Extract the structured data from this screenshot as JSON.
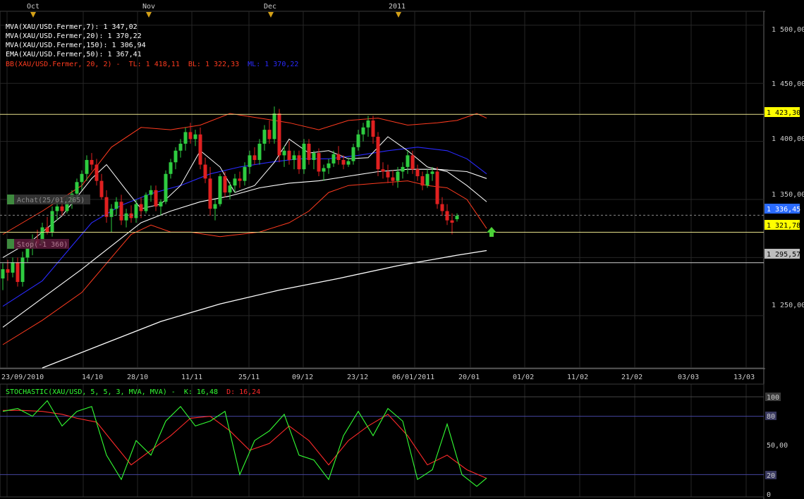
{
  "top_axis": {
    "months": [
      "Oct",
      "Nov",
      "Dec",
      "2011"
    ]
  },
  "legend": [
    {
      "text": "MVA(XAU/USD.Fermer,7): 1 347,02",
      "color": "#ffffff"
    },
    {
      "text": "MVA(XAU/USD.Fermer,20): 1 370,22",
      "color": "#ffffff"
    },
    {
      "text": "MVA(XAU/USD.Fermer,150): 1 306,94",
      "color": "#ffffff"
    },
    {
      "text": "EMA(XAU/USD.Fermer,50): 1 367,41",
      "color": "#ffffff"
    }
  ],
  "legend_bb": {
    "prefix": "BB(XAU/USD.Fermer, 20, 2) -",
    "tl": "TL: 1 418,11",
    "bl": "BL: 1 322,33",
    "ml": "ML: 1 370,22",
    "color": "#ff3b1f",
    "ml_color": "#2a2aff"
  },
  "price_axis": {
    "ticks": [
      "1 500,00",
      "1 450,00",
      "1 400,00",
      "1 350,00",
      "1 250,00"
    ]
  },
  "price_tags": [
    {
      "label": "1 423,30",
      "bg": "#ffff00",
      "fg": "#000000"
    },
    {
      "label": "1 336,45",
      "bg": "#2a6bff",
      "fg": "#ffffff"
    },
    {
      "label": "1 321,78",
      "bg": "#ffff00",
      "fg": "#000000"
    },
    {
      "label": "1 295,57",
      "bg": "#bdbdbd",
      "fg": "#000000"
    }
  ],
  "annotations": {
    "achat": "Achat(25/01,265)",
    "stop": "Stop(-1 360)"
  },
  "date_axis": {
    "labels": [
      "23/09/2010",
      "14/10",
      "28/10",
      "11/11",
      "25/11",
      "09/12",
      "23/12",
      "06/01/2011",
      "20/01",
      "01/02",
      "11/02",
      "21/02",
      "03/03",
      "13/03"
    ]
  },
  "stoch_legend": {
    "prefix": "STOCHASTIC(XAU/USD, 5, 5, 3, MVA, MVA) -",
    "k": "K: 16,48",
    "d": "D: 16,24",
    "k_color": "#33ff33",
    "d_color": "#ff2a2a"
  },
  "stoch_axis": {
    "ticks": [
      "100",
      "80",
      "50,00",
      "20",
      "0"
    ]
  },
  "chart_data": {
    "type": "candlestick",
    "instrument": "XAU/USD",
    "price_ylim": [
      1205,
      1512
    ],
    "candles": [
      {
        "o": 1282,
        "h": 1295,
        "l": 1272,
        "c": 1290
      },
      {
        "o": 1290,
        "h": 1298,
        "l": 1280,
        "c": 1287
      },
      {
        "o": 1287,
        "h": 1300,
        "l": 1283,
        "c": 1296
      },
      {
        "o": 1296,
        "h": 1300,
        "l": 1275,
        "c": 1279
      },
      {
        "o": 1279,
        "h": 1305,
        "l": 1275,
        "c": 1300
      },
      {
        "o": 1300,
        "h": 1312,
        "l": 1296,
        "c": 1308
      },
      {
        "o": 1308,
        "h": 1320,
        "l": 1302,
        "c": 1316
      },
      {
        "o": 1316,
        "h": 1324,
        "l": 1308,
        "c": 1312
      },
      {
        "o": 1312,
        "h": 1330,
        "l": 1310,
        "c": 1326
      },
      {
        "o": 1326,
        "h": 1335,
        "l": 1320,
        "c": 1322
      },
      {
        "o": 1322,
        "h": 1344,
        "l": 1318,
        "c": 1340
      },
      {
        "o": 1340,
        "h": 1348,
        "l": 1332,
        "c": 1344
      },
      {
        "o": 1344,
        "h": 1350,
        "l": 1336,
        "c": 1340
      },
      {
        "o": 1340,
        "h": 1352,
        "l": 1338,
        "c": 1348
      },
      {
        "o": 1348,
        "h": 1358,
        "l": 1342,
        "c": 1355
      },
      {
        "o": 1355,
        "h": 1368,
        "l": 1350,
        "c": 1365
      },
      {
        "o": 1365,
        "h": 1375,
        "l": 1358,
        "c": 1372
      },
      {
        "o": 1372,
        "h": 1388,
        "l": 1366,
        "c": 1384
      },
      {
        "o": 1384,
        "h": 1390,
        "l": 1375,
        "c": 1380
      },
      {
        "o": 1380,
        "h": 1385,
        "l": 1362,
        "c": 1366
      },
      {
        "o": 1366,
        "h": 1372,
        "l": 1350,
        "c": 1352
      },
      {
        "o": 1352,
        "h": 1358,
        "l": 1330,
        "c": 1335
      },
      {
        "o": 1335,
        "h": 1346,
        "l": 1322,
        "c": 1342
      },
      {
        "o": 1342,
        "h": 1352,
        "l": 1336,
        "c": 1348
      },
      {
        "o": 1348,
        "h": 1354,
        "l": 1328,
        "c": 1332
      },
      {
        "o": 1332,
        "h": 1342,
        "l": 1326,
        "c": 1338
      },
      {
        "o": 1338,
        "h": 1345,
        "l": 1330,
        "c": 1334
      },
      {
        "o": 1334,
        "h": 1350,
        "l": 1330,
        "c": 1346
      },
      {
        "o": 1346,
        "h": 1352,
        "l": 1334,
        "c": 1340
      },
      {
        "o": 1340,
        "h": 1356,
        "l": 1338,
        "c": 1354
      },
      {
        "o": 1354,
        "h": 1362,
        "l": 1348,
        "c": 1358
      },
      {
        "o": 1358,
        "h": 1362,
        "l": 1340,
        "c": 1344
      },
      {
        "o": 1344,
        "h": 1350,
        "l": 1336,
        "c": 1348
      },
      {
        "o": 1348,
        "h": 1375,
        "l": 1346,
        "c": 1372
      },
      {
        "o": 1372,
        "h": 1385,
        "l": 1368,
        "c": 1382
      },
      {
        "o": 1382,
        "h": 1395,
        "l": 1376,
        "c": 1392
      },
      {
        "o": 1392,
        "h": 1402,
        "l": 1386,
        "c": 1398
      },
      {
        "o": 1398,
        "h": 1412,
        "l": 1392,
        "c": 1408
      },
      {
        "o": 1408,
        "h": 1416,
        "l": 1398,
        "c": 1402
      },
      {
        "o": 1402,
        "h": 1410,
        "l": 1396,
        "c": 1406
      },
      {
        "o": 1406,
        "h": 1412,
        "l": 1376,
        "c": 1380
      },
      {
        "o": 1380,
        "h": 1386,
        "l": 1364,
        "c": 1368
      },
      {
        "o": 1368,
        "h": 1378,
        "l": 1336,
        "c": 1342
      },
      {
        "o": 1342,
        "h": 1350,
        "l": 1332,
        "c": 1346
      },
      {
        "o": 1346,
        "h": 1372,
        "l": 1344,
        "c": 1370
      },
      {
        "o": 1370,
        "h": 1374,
        "l": 1352,
        "c": 1356
      },
      {
        "o": 1356,
        "h": 1365,
        "l": 1350,
        "c": 1362
      },
      {
        "o": 1362,
        "h": 1372,
        "l": 1356,
        "c": 1368
      },
      {
        "o": 1368,
        "h": 1374,
        "l": 1360,
        "c": 1366
      },
      {
        "o": 1366,
        "h": 1382,
        "l": 1362,
        "c": 1378
      },
      {
        "o": 1378,
        "h": 1392,
        "l": 1372,
        "c": 1388
      },
      {
        "o": 1388,
        "h": 1395,
        "l": 1380,
        "c": 1384
      },
      {
        "o": 1384,
        "h": 1402,
        "l": 1380,
        "c": 1398
      },
      {
        "o": 1398,
        "h": 1414,
        "l": 1392,
        "c": 1410
      },
      {
        "o": 1410,
        "h": 1418,
        "l": 1398,
        "c": 1402
      },
      {
        "o": 1402,
        "h": 1430,
        "l": 1398,
        "c": 1424
      },
      {
        "o": 1424,
        "h": 1428,
        "l": 1382,
        "c": 1388
      },
      {
        "o": 1388,
        "h": 1396,
        "l": 1378,
        "c": 1392
      },
      {
        "o": 1392,
        "h": 1400,
        "l": 1380,
        "c": 1384
      },
      {
        "o": 1384,
        "h": 1392,
        "l": 1376,
        "c": 1388
      },
      {
        "o": 1388,
        "h": 1392,
        "l": 1372,
        "c": 1376
      },
      {
        "o": 1376,
        "h": 1402,
        "l": 1372,
        "c": 1398
      },
      {
        "o": 1398,
        "h": 1402,
        "l": 1380,
        "c": 1384
      },
      {
        "o": 1384,
        "h": 1392,
        "l": 1376,
        "c": 1390
      },
      {
        "o": 1390,
        "h": 1394,
        "l": 1370,
        "c": 1374
      },
      {
        "o": 1374,
        "h": 1380,
        "l": 1366,
        "c": 1377
      },
      {
        "o": 1377,
        "h": 1385,
        "l": 1372,
        "c": 1381
      },
      {
        "o": 1381,
        "h": 1392,
        "l": 1378,
        "c": 1389
      },
      {
        "o": 1389,
        "h": 1396,
        "l": 1380,
        "c": 1384
      },
      {
        "o": 1384,
        "h": 1388,
        "l": 1376,
        "c": 1380
      },
      {
        "o": 1380,
        "h": 1386,
        "l": 1378,
        "c": 1383
      },
      {
        "o": 1383,
        "h": 1398,
        "l": 1380,
        "c": 1395
      },
      {
        "o": 1395,
        "h": 1410,
        "l": 1392,
        "c": 1406
      },
      {
        "o": 1406,
        "h": 1416,
        "l": 1400,
        "c": 1412
      },
      {
        "o": 1412,
        "h": 1422,
        "l": 1404,
        "c": 1418
      },
      {
        "o": 1418,
        "h": 1422,
        "l": 1398,
        "c": 1404
      },
      {
        "o": 1404,
        "h": 1408,
        "l": 1370,
        "c": 1376
      },
      {
        "o": 1376,
        "h": 1382,
        "l": 1368,
        "c": 1374
      },
      {
        "o": 1374,
        "h": 1380,
        "l": 1364,
        "c": 1369
      },
      {
        "o": 1369,
        "h": 1375,
        "l": 1362,
        "c": 1366
      },
      {
        "o": 1366,
        "h": 1378,
        "l": 1360,
        "c": 1374
      },
      {
        "o": 1374,
        "h": 1382,
        "l": 1368,
        "c": 1378
      },
      {
        "o": 1378,
        "h": 1392,
        "l": 1372,
        "c": 1388
      },
      {
        "o": 1388,
        "h": 1392,
        "l": 1372,
        "c": 1376
      },
      {
        "o": 1376,
        "h": 1380,
        "l": 1366,
        "c": 1370
      },
      {
        "o": 1370,
        "h": 1374,
        "l": 1358,
        "c": 1362
      },
      {
        "o": 1362,
        "h": 1376,
        "l": 1360,
        "c": 1372
      },
      {
        "o": 1372,
        "h": 1378,
        "l": 1366,
        "c": 1374
      },
      {
        "o": 1374,
        "h": 1378,
        "l": 1342,
        "c": 1346
      },
      {
        "o": 1346,
        "h": 1352,
        "l": 1336,
        "c": 1340
      },
      {
        "o": 1340,
        "h": 1346,
        "l": 1328,
        "c": 1332
      },
      {
        "o": 1332,
        "h": 1338,
        "l": 1320,
        "c": 1330
      },
      {
        "o": 1333,
        "h": 1338,
        "l": 1331,
        "c": 1336
      }
    ],
    "bb_upper": [
      [
        0,
        1320
      ],
      [
        8,
        1340
      ],
      [
        16,
        1362
      ],
      [
        22,
        1395
      ],
      [
        28,
        1412
      ],
      [
        34,
        1410
      ],
      [
        40,
        1414
      ],
      [
        46,
        1424
      ],
      [
        52,
        1420
      ],
      [
        58,
        1416
      ],
      [
        64,
        1410
      ],
      [
        70,
        1418
      ],
      [
        76,
        1420
      ],
      [
        82,
        1414
      ],
      [
        88,
        1416
      ],
      [
        92,
        1418
      ],
      [
        96,
        1424
      ],
      [
        98,
        1420
      ]
    ],
    "bb_lower": [
      [
        0,
        1225
      ],
      [
        8,
        1246
      ],
      [
        16,
        1270
      ],
      [
        22,
        1300
      ],
      [
        26,
        1320
      ],
      [
        30,
        1328
      ],
      [
        34,
        1322
      ],
      [
        38,
        1322
      ],
      [
        44,
        1318
      ],
      [
        48,
        1320
      ],
      [
        52,
        1322
      ],
      [
        58,
        1330
      ],
      [
        62,
        1340
      ],
      [
        66,
        1356
      ],
      [
        70,
        1362
      ],
      [
        76,
        1364
      ],
      [
        82,
        1366
      ],
      [
        86,
        1362
      ],
      [
        90,
        1360
      ],
      [
        94,
        1350
      ],
      [
        98,
        1325
      ]
    ],
    "mva7": [
      [
        0,
        1300
      ],
      [
        6,
        1315
      ],
      [
        12,
        1336
      ],
      [
        18,
        1368
      ],
      [
        21,
        1380
      ],
      [
        25,
        1358
      ],
      [
        28,
        1342
      ],
      [
        32,
        1346
      ],
      [
        36,
        1362
      ],
      [
        40,
        1392
      ],
      [
        44,
        1378
      ],
      [
        47,
        1356
      ],
      [
        51,
        1362
      ],
      [
        55,
        1382
      ],
      [
        58,
        1402
      ],
      [
        62,
        1390
      ],
      [
        66,
        1392
      ],
      [
        70,
        1385
      ],
      [
        74,
        1386
      ],
      [
        78,
        1404
      ],
      [
        82,
        1392
      ],
      [
        86,
        1378
      ],
      [
        90,
        1374
      ],
      [
        94,
        1362
      ],
      [
        98,
        1348
      ]
    ],
    "mva20": [
      [
        0,
        1258
      ],
      [
        8,
        1280
      ],
      [
        14,
        1310
      ],
      [
        18,
        1330
      ],
      [
        24,
        1345
      ],
      [
        30,
        1355
      ],
      [
        36,
        1362
      ],
      [
        42,
        1372
      ],
      [
        48,
        1378
      ],
      [
        54,
        1382
      ],
      [
        60,
        1385
      ],
      [
        66,
        1385
      ],
      [
        72,
        1388
      ],
      [
        78,
        1392
      ],
      [
        84,
        1395
      ],
      [
        90,
        1392
      ],
      [
        94,
        1385
      ],
      [
        98,
        1372
      ]
    ],
    "ema50": [
      [
        0,
        1240
      ],
      [
        8,
        1265
      ],
      [
        16,
        1290
      ],
      [
        22,
        1310
      ],
      [
        28,
        1330
      ],
      [
        34,
        1340
      ],
      [
        40,
        1348
      ],
      [
        46,
        1353
      ],
      [
        52,
        1360
      ],
      [
        58,
        1364
      ],
      [
        64,
        1366
      ],
      [
        70,
        1370
      ],
      [
        76,
        1374
      ],
      [
        82,
        1376
      ],
      [
        88,
        1376
      ],
      [
        94,
        1374
      ],
      [
        98,
        1368
      ]
    ],
    "mva150": [
      [
        8,
        1205
      ],
      [
        20,
        1225
      ],
      [
        32,
        1245
      ],
      [
        44,
        1260
      ],
      [
        56,
        1272
      ],
      [
        68,
        1282
      ],
      [
        80,
        1293
      ],
      [
        92,
        1302
      ],
      [
        98,
        1306
      ]
    ],
    "hlines": [
      1423.3,
      1321.78,
      1295.57
    ],
    "dashed_line": 1336.45,
    "stochastic": {
      "k": [
        [
          0,
          85
        ],
        [
          3,
          88
        ],
        [
          6,
          80
        ],
        [
          9,
          96
        ],
        [
          12,
          70
        ],
        [
          15,
          85
        ],
        [
          18,
          90
        ],
        [
          21,
          40
        ],
        [
          24,
          15
        ],
        [
          27,
          55
        ],
        [
          30,
          40
        ],
        [
          33,
          75
        ],
        [
          36,
          90
        ],
        [
          39,
          70
        ],
        [
          42,
          75
        ],
        [
          45,
          85
        ],
        [
          48,
          20
        ],
        [
          51,
          55
        ],
        [
          54,
          65
        ],
        [
          57,
          82
        ],
        [
          60,
          40
        ],
        [
          63,
          35
        ],
        [
          66,
          15
        ],
        [
          69,
          60
        ],
        [
          72,
          85
        ],
        [
          75,
          60
        ],
        [
          78,
          88
        ],
        [
          81,
          75
        ],
        [
          84,
          15
        ],
        [
          87,
          25
        ],
        [
          90,
          72
        ],
        [
          93,
          20
        ],
        [
          96,
          8
        ],
        [
          98,
          16.48
        ]
      ],
      "d": [
        [
          0,
          86
        ],
        [
          4,
          86
        ],
        [
          8,
          85
        ],
        [
          12,
          82
        ],
        [
          15,
          78
        ],
        [
          19,
          74
        ],
        [
          22,
          55
        ],
        [
          26,
          30
        ],
        [
          30,
          45
        ],
        [
          34,
          60
        ],
        [
          38,
          78
        ],
        [
          42,
          80
        ],
        [
          46,
          65
        ],
        [
          50,
          45
        ],
        [
          54,
          52
        ],
        [
          58,
          70
        ],
        [
          62,
          55
        ],
        [
          66,
          30
        ],
        [
          70,
          55
        ],
        [
          74,
          70
        ],
        [
          78,
          82
        ],
        [
          82,
          60
        ],
        [
          86,
          30
        ],
        [
          90,
          40
        ],
        [
          94,
          25
        ],
        [
          98,
          16.24
        ]
      ],
      "ylim": [
        0,
        100
      ],
      "levels": [
        80,
        20
      ]
    }
  }
}
